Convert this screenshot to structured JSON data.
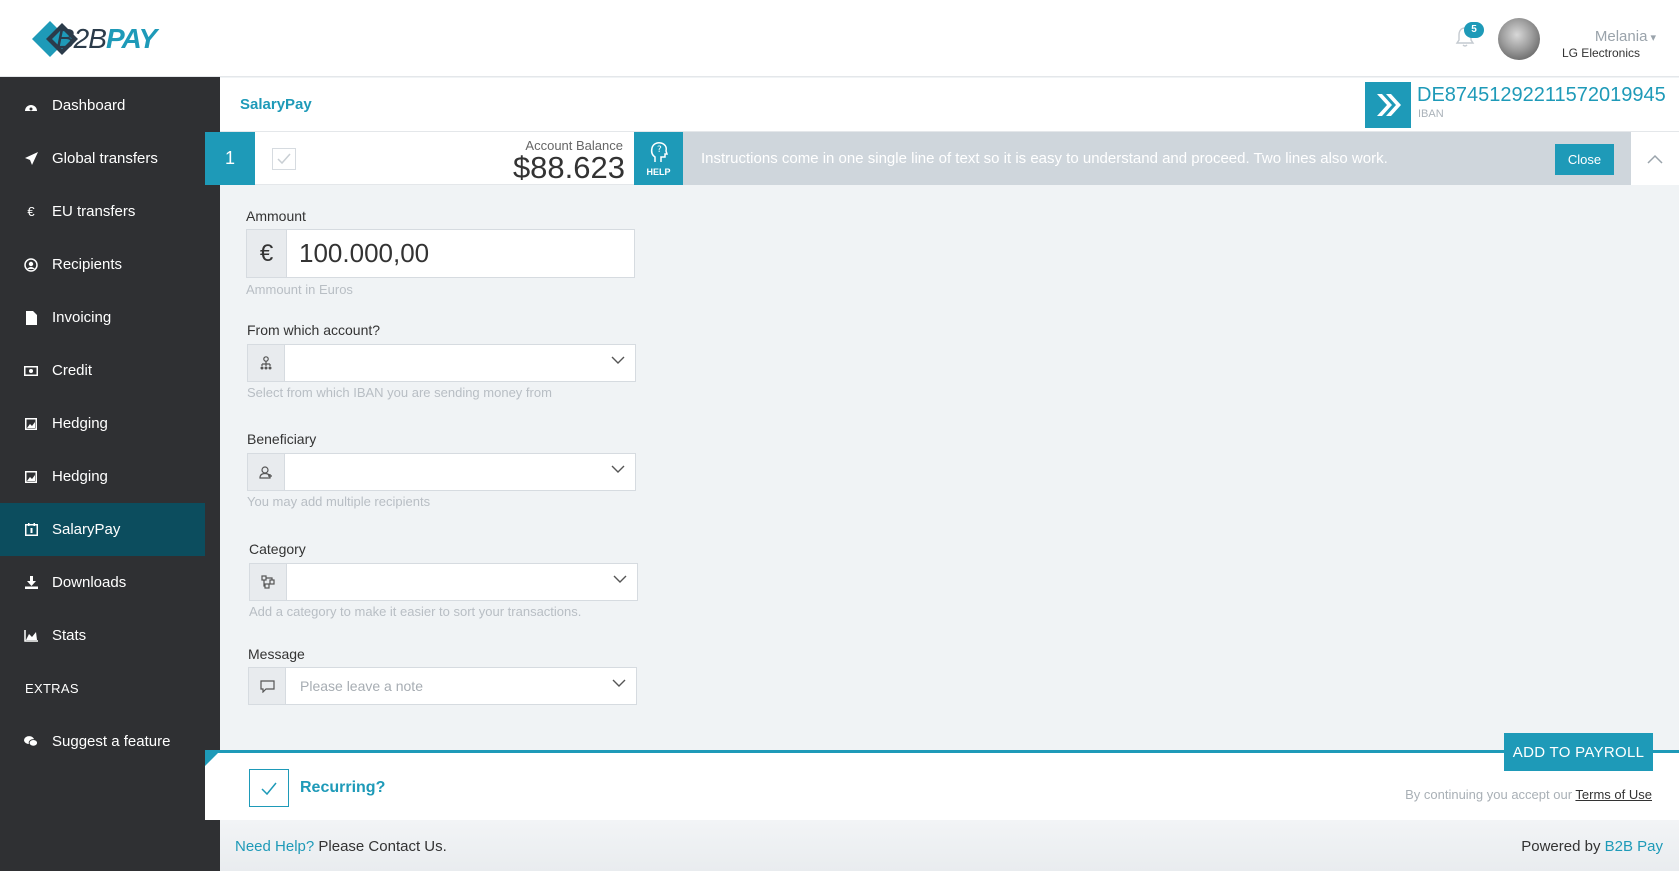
{
  "brand": {
    "logo_text_light": "B2B",
    "logo_text_bold": "PAY",
    "accent": "#1e9ab8",
    "sidebar_bg": "#2f3033",
    "active_bg": "#0c4d5e"
  },
  "header": {
    "notifications_count": "5",
    "user_name": "Melania",
    "user_company": "LG Electronics"
  },
  "sidebar": {
    "items": [
      {
        "label": "Dashboard",
        "icon": "dashboard-icon"
      },
      {
        "label": "Global transfers",
        "icon": "plane-icon"
      },
      {
        "label": "EU transfers",
        "icon": "euro-icon"
      },
      {
        "label": "Recipients",
        "icon": "user-circle-icon"
      },
      {
        "label": "Invoicing",
        "icon": "file-icon"
      },
      {
        "label": "Credit",
        "icon": "money-icon"
      },
      {
        "label": "Hedging",
        "icon": "image-icon"
      },
      {
        "label": "Hedging",
        "icon": "image-icon"
      },
      {
        "label": "SalaryPay",
        "icon": "calendar-icon",
        "active": true
      },
      {
        "label": "Downloads",
        "icon": "download-icon"
      },
      {
        "label": "Stats",
        "icon": "area-chart-icon"
      }
    ],
    "extras_title": "EXTRAS",
    "suggest_label": "Suggest a feature"
  },
  "page": {
    "title": "SalaryPay",
    "iban_number": "DE87451292211572019945",
    "iban_label": "IBAN"
  },
  "step": {
    "number": "1",
    "balance_label": "Account Balance",
    "balance_value": "$88.623",
    "help_label": "HELP",
    "instructions": "Instructions come in one single line of text so it is easy to understand and proceed. Two lines also work.",
    "close_label": "Close"
  },
  "form": {
    "amount_label": "Ammount",
    "amount_symbol": "€",
    "amount_value": "100.000,00",
    "amount_help": "Ammount in Euros",
    "account_label": "From which account?",
    "account_help": "Select from which IBAN you are sending money from",
    "beneficiary_label": "Beneficiary",
    "beneficiary_help": "You may add multiple recipients",
    "category_label": "Category",
    "category_help": "Add a category to make it easier to sort your transactions.",
    "message_label": "Message",
    "message_placeholder": "Please leave a note"
  },
  "actions": {
    "add_label": "ADD TO PAYROLL",
    "recurring_label": "Recurring?",
    "terms_prefix": "By continuing you accept our",
    "terms_link": "Terms of Use"
  },
  "footer": {
    "need_help": "Need Help?",
    "contact": "Please Contact Us.",
    "powered_prefix": "Powered by",
    "powered_brand": "B2B Pay"
  }
}
